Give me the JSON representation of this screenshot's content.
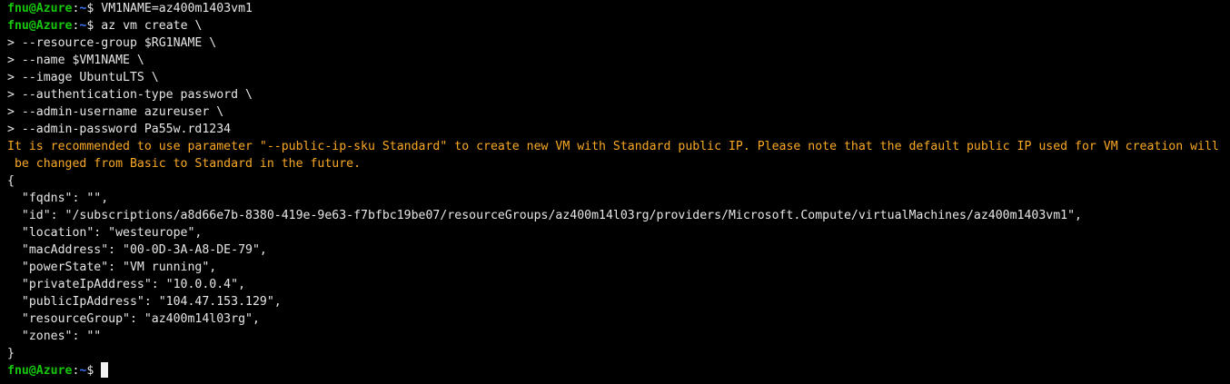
{
  "prompt": {
    "user": "fnu@Azure",
    "sep": ":",
    "path": "~",
    "symbol": "$"
  },
  "lines": [
    {
      "type": "prompt",
      "cmd": " VM1NAME=az400m1403vm1"
    },
    {
      "type": "prompt",
      "cmd": " az vm create \\"
    },
    {
      "type": "cont",
      "text": "> --resource-group $RG1NAME \\"
    },
    {
      "type": "cont",
      "text": "> --name $VM1NAME \\"
    },
    {
      "type": "cont",
      "text": "> --image UbuntuLTS \\"
    },
    {
      "type": "cont",
      "text": "> --authentication-type password \\"
    },
    {
      "type": "cont",
      "text": "> --admin-username azureuser \\"
    },
    {
      "type": "cont",
      "text": "> --admin-password Pa55w.rd1234"
    },
    {
      "type": "warn",
      "text": "It is recommended to use parameter \"--public-ip-sku Standard\" to create new VM with Standard public IP. Please note that the default public IP used for VM creation will"
    },
    {
      "type": "warn",
      "text": " be changed from Basic to Standard in the future."
    },
    {
      "type": "out",
      "text": "{"
    },
    {
      "type": "out",
      "text": "  \"fqdns\": \"\","
    },
    {
      "type": "out",
      "text": "  \"id\": \"/subscriptions/a8d66e7b-8380-419e-9e63-f7bfbc19be07/resourceGroups/az400m14l03rg/providers/Microsoft.Compute/virtualMachines/az400m1403vm1\","
    },
    {
      "type": "out",
      "text": "  \"location\": \"westeurope\","
    },
    {
      "type": "out",
      "text": "  \"macAddress\": \"00-0D-3A-A8-DE-79\","
    },
    {
      "type": "out",
      "text": "  \"powerState\": \"VM running\","
    },
    {
      "type": "out",
      "text": "  \"privateIpAddress\": \"10.0.0.4\","
    },
    {
      "type": "out",
      "text": "  \"publicIpAddress\": \"104.47.153.129\","
    },
    {
      "type": "out",
      "text": "  \"resourceGroup\": \"az400m14l03rg\","
    },
    {
      "type": "out",
      "text": "  \"zones\": \"\""
    },
    {
      "type": "out",
      "text": "}"
    },
    {
      "type": "prompt",
      "cmd": " "
    }
  ],
  "colors": {
    "background": "#000000",
    "user": "#16c60c",
    "path": "#3b78ff",
    "warning": "#f9a825",
    "text": "#e6e6e6"
  }
}
